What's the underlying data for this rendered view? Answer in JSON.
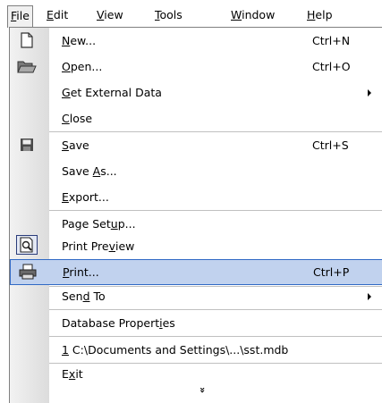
{
  "menubar": {
    "items": [
      {
        "name": "menu-file",
        "pre": "",
        "acc": "F",
        "post": "ile"
      },
      {
        "name": "menu-edit",
        "pre": "",
        "acc": "E",
        "post": "dit"
      },
      {
        "name": "menu-view",
        "pre": "",
        "acc": "V",
        "post": "iew"
      },
      {
        "name": "menu-tools",
        "pre": "",
        "acc": "T",
        "post": "ools"
      },
      {
        "name": "menu-window",
        "pre": "",
        "acc": "W",
        "post": "indow"
      },
      {
        "name": "menu-help",
        "pre": "",
        "acc": "H",
        "post": "elp"
      }
    ]
  },
  "file_menu": {
    "items": [
      {
        "pre": "",
        "acc": "N",
        "post": "ew...",
        "shortcut": "Ctrl+N",
        "icon": "new-document-icon"
      },
      {
        "pre": "",
        "acc": "O",
        "post": "pen...",
        "shortcut": "Ctrl+O",
        "icon": "open-folder-icon"
      },
      {
        "pre": "",
        "acc": "G",
        "post": "et External Data",
        "shortcut": "",
        "submenu": true
      },
      {
        "pre": "",
        "acc": "C",
        "post": "lose",
        "shortcut": ""
      },
      {
        "pre": "",
        "acc": "S",
        "post": "ave",
        "shortcut": "Ctrl+S",
        "icon": "save-disk-icon"
      },
      {
        "pre": "Save ",
        "acc": "A",
        "post": "s...",
        "shortcut": ""
      },
      {
        "pre": "",
        "acc": "E",
        "post": "xport...",
        "shortcut": ""
      },
      {
        "pre": "Page Set",
        "acc": "u",
        "post": "p...",
        "shortcut": ""
      },
      {
        "pre": "Print Pre",
        "acc": "v",
        "post": "iew",
        "shortcut": "",
        "icon": "print-preview-icon"
      },
      {
        "pre": "",
        "acc": "P",
        "post": "rint...",
        "shortcut": "Ctrl+P",
        "icon": "printer-icon"
      },
      {
        "pre": "Sen",
        "acc": "d",
        "post": " To",
        "shortcut": "",
        "submenu": true
      },
      {
        "pre": "Database Propert",
        "acc": "i",
        "post": "es",
        "shortcut": ""
      },
      {
        "pre": "",
        "acc": "1",
        "post": " C:\\Documents and Settings\\...\\sst.mdb",
        "shortcut": ""
      },
      {
        "pre": "E",
        "acc": "x",
        "post": "it",
        "shortcut": ""
      }
    ],
    "more_glyph": "»"
  }
}
